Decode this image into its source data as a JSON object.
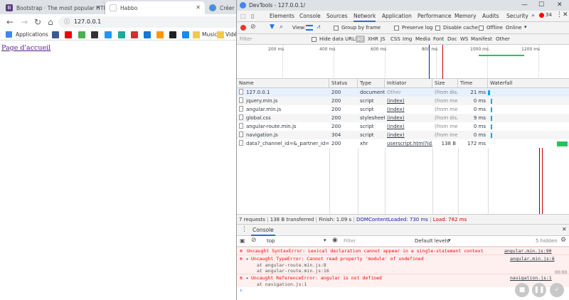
{
  "browser": {
    "tabs": [
      {
        "label": "Bootstrap · The most popular HTML",
        "favicon_color": "#563d7c"
      },
      {
        "label": "Habbo",
        "favicon_color": "#ffffff"
      },
      {
        "label": "Créer un",
        "favicon_color": "#4a90d9"
      }
    ],
    "url": "127.0.0.1",
    "bookmarks": {
      "apps_label": "Applications",
      "music_label": "Music",
      "videos_label": "Vidéos"
    },
    "page_link": "Page d'accueil"
  },
  "devtools": {
    "window_title": "DevTools - 127.0.0.1/",
    "panels": [
      "Elements",
      "Console",
      "Sources",
      "Network",
      "Application",
      "Performance",
      "Memory",
      "Audits",
      "Security"
    ],
    "active_panel": "Network",
    "error_count": "34",
    "toolbar": {
      "view_label": "View:",
      "group_by_frame": "Group by frame",
      "preserve_log": "Preserve log",
      "disable_cache": "Disable cache",
      "offline": "Offline",
      "throttle": "Online"
    },
    "filter": {
      "placeholder": "Filter",
      "hide_data_urls": "Hide data URLs",
      "types": [
        "All",
        "XHR",
        "JS",
        "CSS",
        "Img",
        "Media",
        "Font",
        "Doc",
        "WS",
        "Manifest",
        "Other"
      ]
    },
    "timeline_ticks": [
      "200 ms",
      "400 ms",
      "600 ms",
      "800 ms",
      "1000 ms",
      "1200 ms"
    ],
    "columns": [
      "Name",
      "Status",
      "Type",
      "Initiator",
      "Size",
      "Time",
      "Waterfall"
    ],
    "requests": [
      {
        "name": "127.0.0.1",
        "status": "200",
        "type": "document",
        "initiator": "Other",
        "size": "(from dis...",
        "time": "21 ms",
        "wf_start": 0.0,
        "wf_len": 0.03
      },
      {
        "name": "jquery.min.js",
        "status": "200",
        "type": "script",
        "initiator": "(index)",
        "size": "(from me...",
        "time": "0 ms",
        "wf_start": 0.035,
        "wf_len": 0.01
      },
      {
        "name": "angular.min.js",
        "status": "200",
        "type": "script",
        "initiator": "(index)",
        "size": "(from me...",
        "time": "0 ms",
        "wf_start": 0.035,
        "wf_len": 0.01
      },
      {
        "name": "global.css",
        "status": "200",
        "type": "stylesheet",
        "initiator": "(index)",
        "size": "(from dis...",
        "time": "9 ms",
        "wf_start": 0.035,
        "wf_len": 0.015
      },
      {
        "name": "angular-route.min.js",
        "status": "200",
        "type": "script",
        "initiator": "(index)",
        "size": "(from me...",
        "time": "0 ms",
        "wf_start": 0.035,
        "wf_len": 0.01
      },
      {
        "name": "navigation.js",
        "status": "304",
        "type": "script",
        "initiator": "(index)",
        "size": "(from me...",
        "time": "0 ms",
        "wf_start": 0.035,
        "wf_len": 0.01
      },
      {
        "name": "data?_channel_id=&_partner_id=39...",
        "status": "200",
        "type": "xhr",
        "initiator": "userscript.html?id...",
        "size": "138 B",
        "time": "172 ms",
        "wf_start": 0.87,
        "wf_len": 0.13
      }
    ],
    "summary": {
      "requests": "7 requests",
      "transferred": "138 B transferred",
      "finish": "Finish: 1.09 s",
      "dcl": "DOMContentLoaded: 730 ms",
      "load": "Load: 782 ms"
    },
    "drawer_tab": "Console",
    "console": {
      "context": "top",
      "filter_placeholder": "Filter",
      "levels": "Default levels",
      "hidden": "5 hidden",
      "messages": [
        {
          "text": "Uncaught SyntaxError: Lexical declaration cannot appear in a single-statement context",
          "source": "angular.min.js:90",
          "stack": []
        },
        {
          "text": "Uncaught TypeError: Cannot read property 'module' of undefined",
          "source": "angular.min.js:8",
          "stack": [
            "at angular-route.min.js:8",
            "at angular-route.min.js:16"
          ]
        },
        {
          "text": "Uncaught ReferenceError: angular is not defined",
          "source": "navigation.js:1",
          "stack": [
            "at navigation.js:1"
          ]
        }
      ],
      "timer": "00:00",
      "prompt": "›"
    },
    "colors": {
      "accent": "#1a73e8",
      "error": "#ff0000",
      "dcl": "#1a1aa6",
      "load": "#c80000",
      "bar": "#00a6ff",
      "xhr": "#27c35a"
    }
  }
}
